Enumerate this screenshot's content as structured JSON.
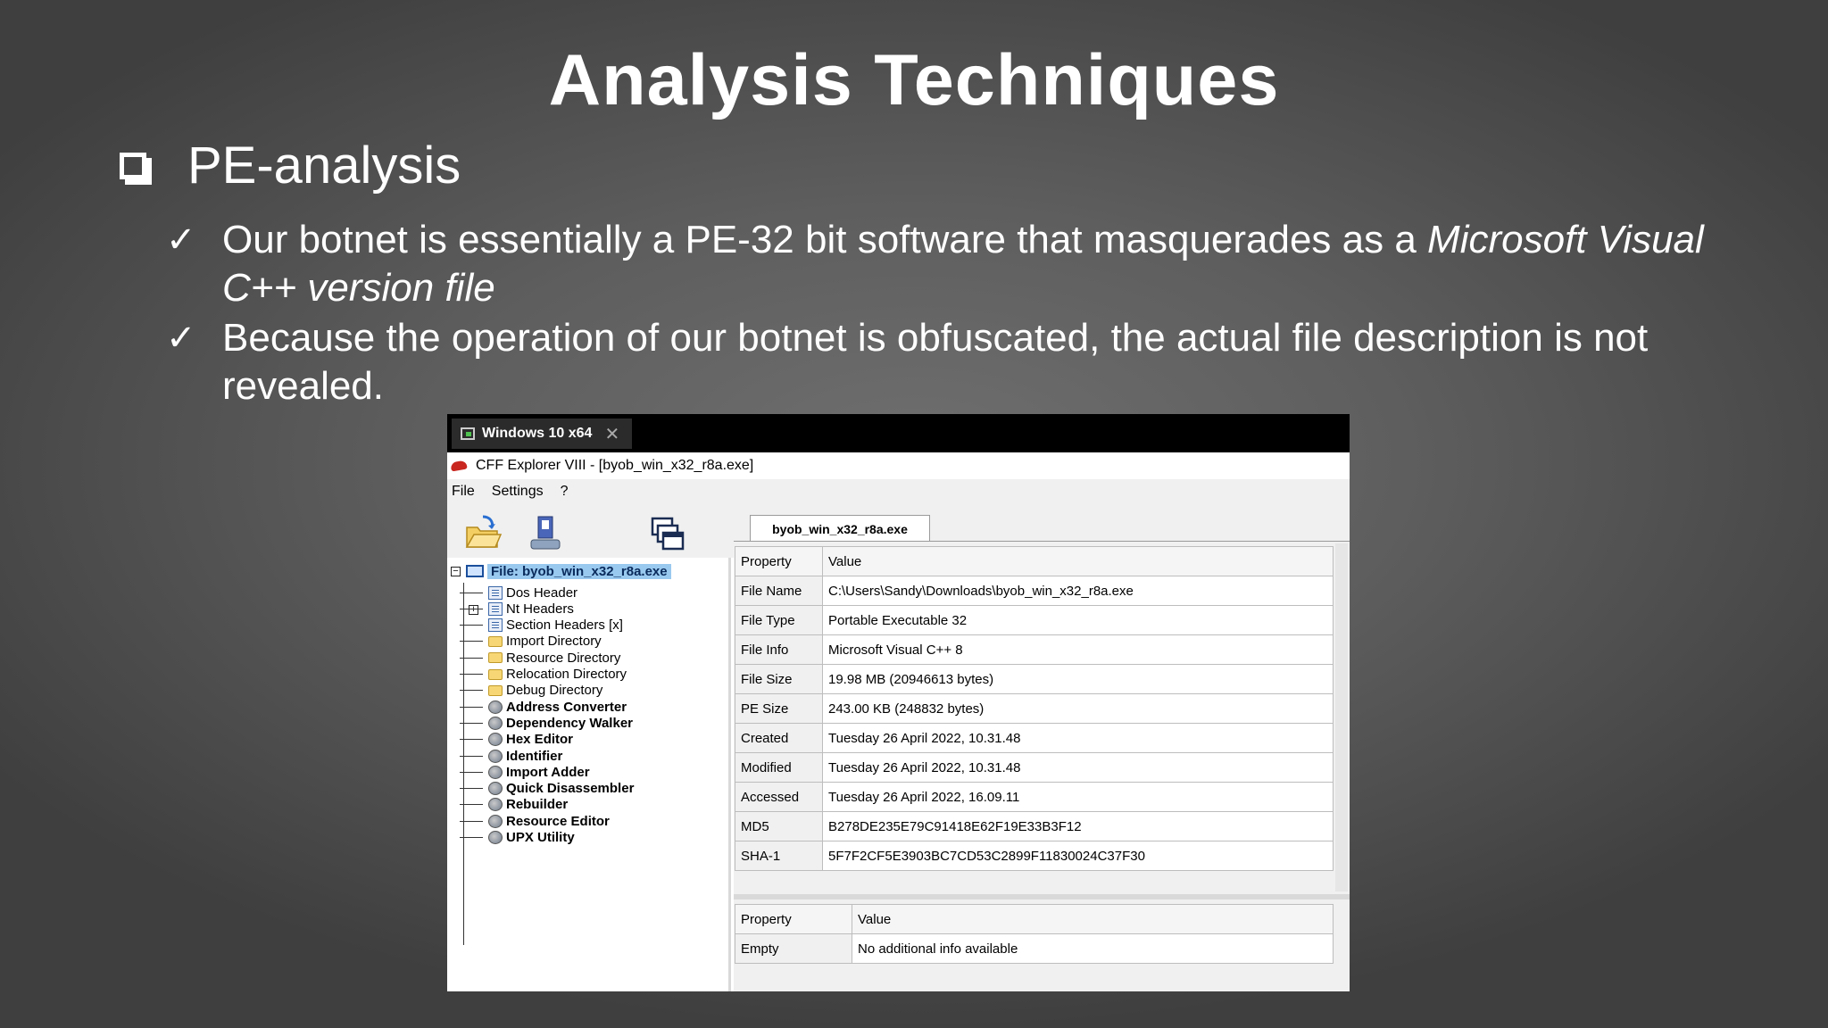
{
  "slide": {
    "title": "Analysis Techniques",
    "main_bullet": "PE-analysis",
    "sub_bullets": {
      "b1_text": "Our botnet is essentially a PE-32 bit software that masquerades as a ",
      "b1_italic": "Microsoft Visual C++ version file",
      "b2_text": "Because the operation of our botnet is obfuscated, the actual file description is not revealed."
    }
  },
  "vm": {
    "tab_label": "Windows 10 x64",
    "close_glyph": "✕"
  },
  "app": {
    "title": "CFF Explorer VIII - [byob_win_x32_r8a.exe]",
    "menu": [
      "File",
      "Settings",
      "?"
    ],
    "tree": {
      "root": "File: byob_win_x32_r8a.exe",
      "items": [
        {
          "label": "Dos Header",
          "icon": "struct-icon",
          "bold": false
        },
        {
          "label": "Nt Headers",
          "icon": "struct-icon",
          "bold": false
        },
        {
          "label": "Section Headers [x]",
          "icon": "struct-icon",
          "bold": false
        },
        {
          "label": "Import Directory",
          "icon": "folder-icon",
          "bold": false
        },
        {
          "label": "Resource Directory",
          "icon": "folder-icon",
          "bold": false
        },
        {
          "label": "Relocation Directory",
          "icon": "folder-icon",
          "bold": false
        },
        {
          "label": "Debug Directory",
          "icon": "folder-icon",
          "bold": false
        },
        {
          "label": "Address Converter",
          "icon": "tool-icon",
          "bold": true
        },
        {
          "label": "Dependency Walker",
          "icon": "tool-icon",
          "bold": true
        },
        {
          "label": "Hex Editor",
          "icon": "tool-icon",
          "bold": true
        },
        {
          "label": "Identifier",
          "icon": "tool-icon",
          "bold": true
        },
        {
          "label": "Import Adder",
          "icon": "tool-icon",
          "bold": true
        },
        {
          "label": "Quick Disassembler",
          "icon": "tool-icon",
          "bold": true
        },
        {
          "label": "Rebuilder",
          "icon": "tool-icon",
          "bold": true
        },
        {
          "label": "Resource Editor",
          "icon": "tool-icon",
          "bold": true
        },
        {
          "label": "UPX Utility",
          "icon": "tool-icon",
          "bold": true
        }
      ]
    },
    "doc_tab": "byob_win_x32_r8a.exe",
    "grid1": {
      "headers": [
        "Property",
        "Value"
      ],
      "rows": [
        [
          "File Name",
          "C:\\Users\\Sandy\\Downloads\\byob_win_x32_r8a.exe"
        ],
        [
          "File Type",
          "Portable Executable 32"
        ],
        [
          "File Info",
          "Microsoft Visual C++ 8"
        ],
        [
          "File Size",
          "19.98 MB (20946613 bytes)"
        ],
        [
          "PE Size",
          "243.00 KB (248832 bytes)"
        ],
        [
          "Created",
          "Tuesday 26 April 2022, 10.31.48"
        ],
        [
          "Modified",
          "Tuesday 26 April 2022, 10.31.48"
        ],
        [
          "Accessed",
          "Tuesday 26 April 2022, 16.09.11"
        ],
        [
          "MD5",
          "B278DE235E79C91418E62F19E33B3F12"
        ],
        [
          "SHA-1",
          "5F7F2CF5E3903BC7CD53C2899F11830024C37F30"
        ]
      ]
    },
    "grid2": {
      "headers": [
        "Property",
        "Value"
      ],
      "rows": [
        [
          "Empty",
          "No additional info available"
        ]
      ]
    }
  }
}
